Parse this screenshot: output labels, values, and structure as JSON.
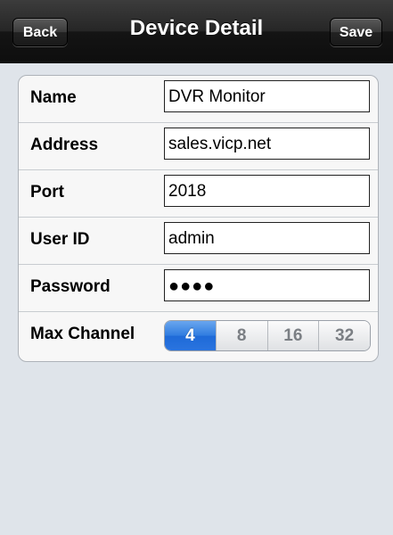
{
  "navbar": {
    "title": "Device Detail",
    "back_label": "Back",
    "save_label": "Save"
  },
  "form": {
    "fields": [
      {
        "label": "Name",
        "value": "DVR Monitor"
      },
      {
        "label": "Address",
        "value": "sales.vicp.net"
      },
      {
        "label": "Port",
        "value": "2018"
      },
      {
        "label": "User ID",
        "value": "admin"
      },
      {
        "label": "Password",
        "value": "●●●●"
      }
    ],
    "max_channel": {
      "label": "Max Channel",
      "options": [
        "4",
        "8",
        "16",
        "32"
      ],
      "selected": "4"
    }
  },
  "colors": {
    "accent": "#2f7ce0",
    "background": "#dfe4ea",
    "navbar": "#1a1a1a"
  }
}
